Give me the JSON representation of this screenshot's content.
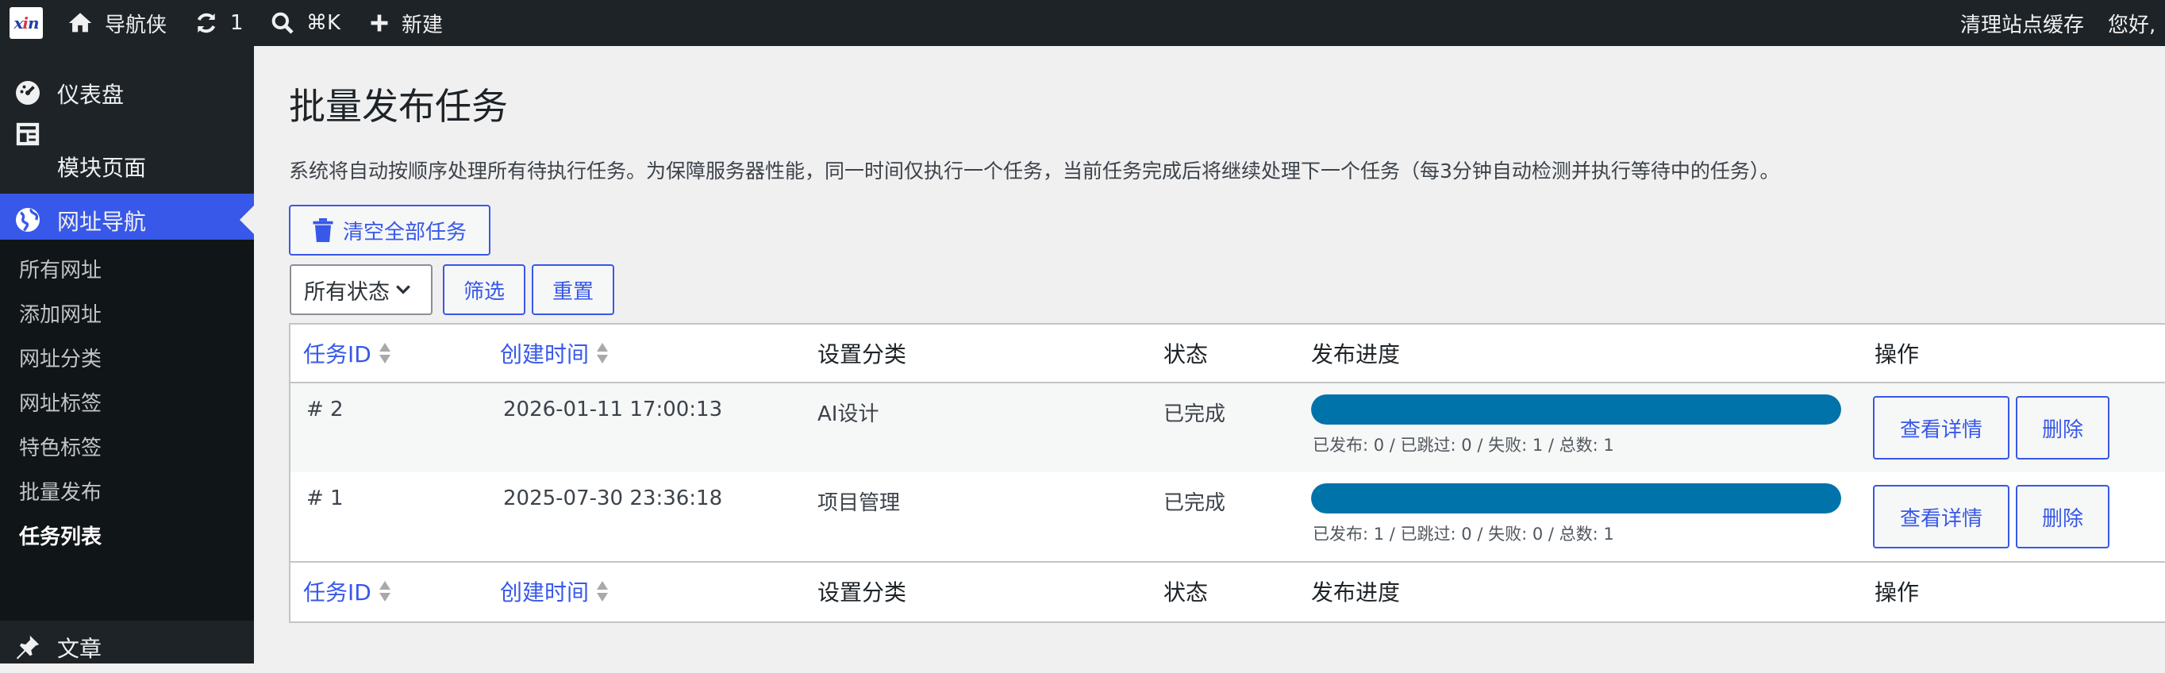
{
  "adminbar": {
    "logo_text": "xin",
    "site_name": "导航侠",
    "updates_count": "1",
    "search_shortcut": "⌘K",
    "new_label": "新建",
    "clear_cache": "清理站点缓存",
    "greeting": "您好,"
  },
  "sidebar": {
    "dashboard": "仪表盘",
    "modules": "模块页面",
    "nav": "网址导航",
    "sub": [
      "所有网址",
      "添加网址",
      "网址分类",
      "网址标签",
      "特色标签",
      "批量发布",
      "任务列表"
    ],
    "posts": "文章"
  },
  "page": {
    "title": "批量发布任务",
    "description": "系统将自动按顺序处理所有待执行任务。为保障服务器性能，同一时间仅执行一个任务，当前任务完成后将继续处理下一个任务（每3分钟自动检测并执行等待中的任务）。",
    "clear_all": "清空全部任务",
    "status_select": "所有状态",
    "filter": "筛选",
    "reset": "重置"
  },
  "table": {
    "headers": {
      "id": "任务ID",
      "created": "创建时间",
      "category": "设置分类",
      "status": "状态",
      "progress": "发布进度",
      "actions": "操作"
    },
    "rows": [
      {
        "id": "# 2",
        "created": "2026-01-11 17:00:13",
        "category": "AI设计",
        "status": "已完成",
        "progress": 1.0,
        "stats": "已发布: 0 / 已跳过: 0 / 失败: 1 / 总数: 1",
        "view": "查看详情",
        "delete": "删除"
      },
      {
        "id": "# 1",
        "created": "2025-07-30 23:36:18",
        "category": "项目管理",
        "status": "已完成",
        "progress": 1.0,
        "stats": "已发布: 1 / 已跳过: 0 / 失败: 0 / 总数: 1",
        "view": "查看详情",
        "delete": "删除"
      }
    ]
  },
  "colors": {
    "accent": "#3858e9",
    "progress": "#0073aa",
    "adminbar": "#1d2327"
  }
}
